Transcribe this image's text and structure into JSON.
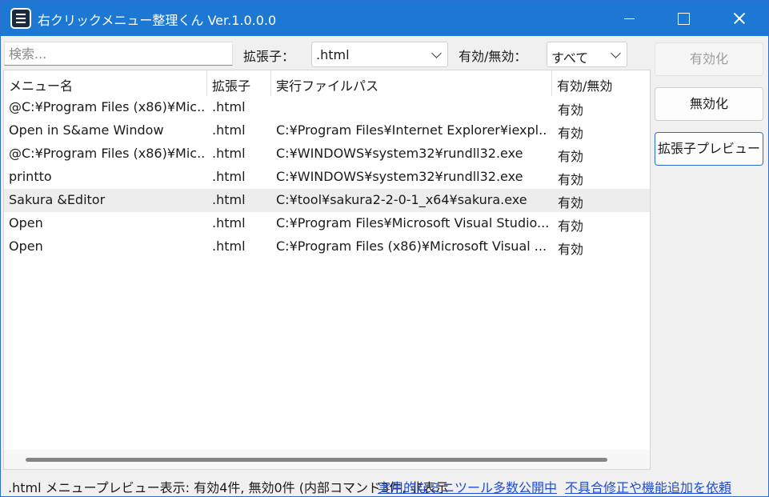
{
  "window": {
    "title": "右クリックメニュー整理くん Ver.1.0.0.0",
    "icon": "app-menu-icon"
  },
  "filters": {
    "search_placeholder": "検索...",
    "ext_label": "拡張子：",
    "ext_value": ".html",
    "state_label": "有効/無効：",
    "state_value": "すべて"
  },
  "buttons": {
    "enable": "有効化",
    "disable": "無効化",
    "preview": "拡張子プレビュー"
  },
  "table": {
    "columns": [
      "メニュー名",
      "拡張子",
      "実行ファイルパス",
      "有効/無効"
    ],
    "rows": [
      [
        "@C:¥Program Files (x86)¥Mic...",
        ".html",
        "",
        "有効"
      ],
      [
        "Open in S&ame Window",
        ".html",
        "C:¥Program Files¥Internet Explorer¥iexpl...",
        "有効"
      ],
      [
        "@C:¥Program Files (x86)¥Mic...",
        ".html",
        "C:¥WINDOWS¥system32¥rundll32.exe",
        "有効"
      ],
      [
        "printto",
        ".html",
        "C:¥WINDOWS¥system32¥rundll32.exe",
        "有効"
      ],
      [
        "Sakura &Editor",
        ".html",
        "C:¥tool¥sakura2-2-0-1_x64¥sakura.exe",
        "有効"
      ],
      [
        "Open",
        ".html",
        "C:¥Program Files¥Microsoft Visual Studio...",
        "有効"
      ],
      [
        "Open",
        ".html",
        "C:¥Program Files (x86)¥Microsoft Visual ...",
        "有効"
      ]
    ],
    "selected_row": 4
  },
  "status": {
    "text": ".html メニュープレビュー表示: 有効4件, 無効0件 (内部コマンド3件, 非表示",
    "link1": "実用的なミニツール多数公開中",
    "link2": "不具合修正や機能追加を依頼"
  },
  "colors": {
    "titlebar": "#1d78d4",
    "link": "#1f4bd8",
    "selected_row": "#ededed"
  }
}
